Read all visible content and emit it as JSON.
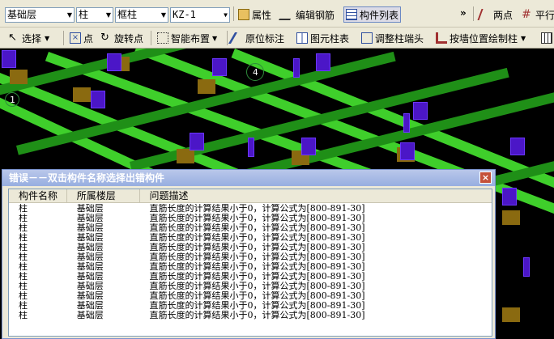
{
  "toolbar1": {
    "floor_select": "基础层",
    "type_select": "柱",
    "subtype_select": "框柱",
    "component_select": "KZ-1",
    "properties_label": "属性",
    "edit_rebar_label": "编辑钢筋",
    "component_list_label": "构件列表",
    "overflow_label": "»",
    "two_point_label": "两点",
    "parallel_label": "平行"
  },
  "toolbar2": {
    "select_label": "选择",
    "point_label": "点",
    "rotate_point_label": "旋转点",
    "smart_layout_label": "智能布置",
    "in_place_label": "原位标注",
    "element_table_label": "图元柱表",
    "adjust_head_label": "调整柱端头",
    "draw_by_wall_label": "按墙位置绘制柱"
  },
  "viewport": {
    "axis_label_4": "4",
    "axis_label_1": "1"
  },
  "error_dialog": {
    "title": "错误－－双击构件名称选择出错构件",
    "columns": [
      "构件名称",
      "所属楼层",
      "问题描述"
    ],
    "rows": [
      [
        "柱",
        "基础层",
        "直筋长度的计算结果小于0，计算公式为[800-891-30]"
      ],
      [
        "柱",
        "基础层",
        "直筋长度的计算结果小于0，计算公式为[800-891-30]"
      ],
      [
        "柱",
        "基础层",
        "直筋长度的计算结果小于0，计算公式为[800-891-30]"
      ],
      [
        "柱",
        "基础层",
        "直筋长度的计算结果小于0，计算公式为[800-891-30]"
      ],
      [
        "柱",
        "基础层",
        "直筋长度的计算结果小于0，计算公式为[800-891-30]"
      ],
      [
        "柱",
        "基础层",
        "直筋长度的计算结果小于0，计算公式为[800-891-30]"
      ],
      [
        "柱",
        "基础层",
        "直筋长度的计算结果小于0，计算公式为[800-891-30]"
      ],
      [
        "柱",
        "基础层",
        "直筋长度的计算结果小于0，计算公式为[800-891-30]"
      ],
      [
        "柱",
        "基础层",
        "直筋长度的计算结果小于0，计算公式为[800-891-30]"
      ],
      [
        "柱",
        "基础层",
        "直筋长度的计算结果小于0，计算公式为[800-891-30]"
      ],
      [
        "柱",
        "基础层",
        "直筋长度的计算结果小于0，计算公式为[800-891-30]"
      ],
      [
        "柱",
        "基础层",
        "直筋长度的计算结果小于0，计算公式为[800-891-30]"
      ]
    ]
  },
  "colors": {
    "beam": "#3fcf2b",
    "column": "#4b16c7",
    "post": "#8a6a10",
    "dialog_title": "#97aee0"
  }
}
